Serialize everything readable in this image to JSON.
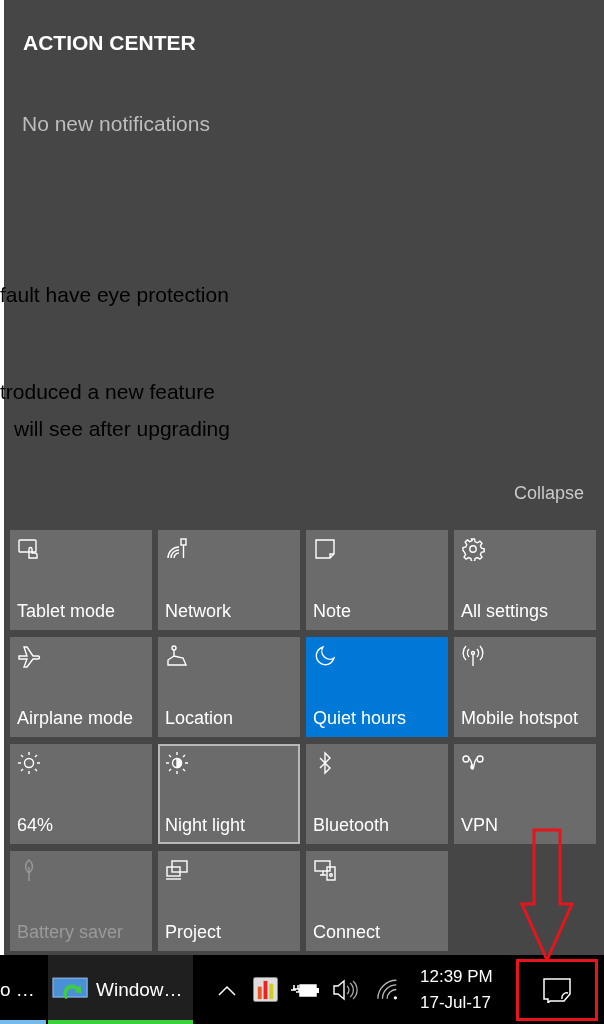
{
  "background_document": {
    "lines": [
      "fault have eye protection",
      "troduced a new feature",
      "will see after upgrading"
    ]
  },
  "action_center": {
    "title": "ACTION CENTER",
    "message": "No new notifications",
    "collapse": "Collapse",
    "tiles": [
      {
        "label": "Tablet mode",
        "on": false,
        "focused": false,
        "disabled": false
      },
      {
        "label": "Network",
        "on": false,
        "focused": false,
        "disabled": false
      },
      {
        "label": "Note",
        "on": false,
        "focused": false,
        "disabled": false
      },
      {
        "label": "All settings",
        "on": false,
        "focused": false,
        "disabled": false
      },
      {
        "label": "Airplane mode",
        "on": false,
        "focused": false,
        "disabled": false
      },
      {
        "label": "Location",
        "on": false,
        "focused": false,
        "disabled": false
      },
      {
        "label": "Quiet hours",
        "on": true,
        "focused": false,
        "disabled": false
      },
      {
        "label": "Mobile hotspot",
        "on": false,
        "focused": false,
        "disabled": false
      },
      {
        "label": "64%",
        "on": false,
        "focused": false,
        "disabled": false
      },
      {
        "label": "Night light",
        "on": false,
        "focused": true,
        "disabled": false
      },
      {
        "label": "Bluetooth",
        "on": false,
        "focused": false,
        "disabled": false
      },
      {
        "label": "VPN",
        "on": false,
        "focused": false,
        "disabled": false
      },
      {
        "label": "Battery saver",
        "on": false,
        "focused": false,
        "disabled": true
      },
      {
        "label": "Project",
        "on": false,
        "focused": false,
        "disabled": false
      },
      {
        "label": "Connect",
        "on": false,
        "focused": false,
        "disabled": false
      }
    ]
  },
  "taskbar": {
    "apps": [
      {
        "label": "o …",
        "selected": false
      },
      {
        "label": "Window…",
        "selected": true
      }
    ],
    "clock": {
      "time": "12:39 PM",
      "date": "17-Jul-17"
    }
  }
}
